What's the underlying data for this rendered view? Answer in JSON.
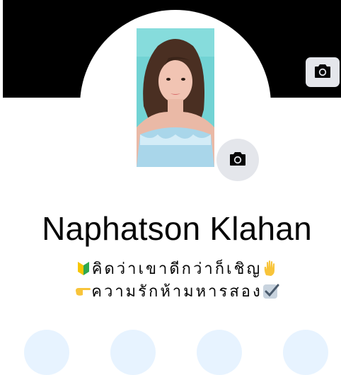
{
  "profile": {
    "name": "Naphatson Klahan",
    "bio_line1": "คิดว่าเขาดีกว่าก็เชิญ",
    "bio_line2": "ความรักห้ามหารสอง"
  },
  "icons": {
    "cover_camera": "camera-icon",
    "photo_camera": "camera-icon",
    "bio_emoji_1": "beginner-symbol-icon",
    "bio_emoji_2": "raised-hand-icon",
    "bio_emoji_3": "pointing-right-icon",
    "bio_emoji_4": "check-mark-icon"
  },
  "colors": {
    "cover": "#000000",
    "button_bg": "#e4e6eb",
    "action_bg": "#e7f3ff",
    "text": "#050505"
  }
}
